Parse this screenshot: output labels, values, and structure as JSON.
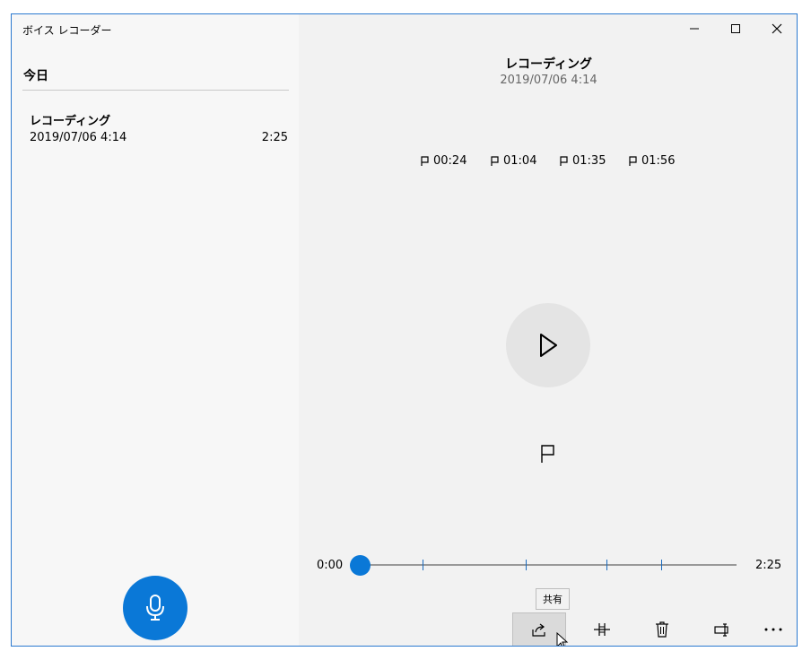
{
  "app": {
    "title": "ボイス レコーダー"
  },
  "sidebar": {
    "section_title": "今日",
    "recordings": [
      {
        "name": "レコーディング",
        "date": "2019/07/06 4:14",
        "duration": "2:25"
      }
    ]
  },
  "player": {
    "title": "レコーディング",
    "date": "2019/07/06 4:14",
    "markers": [
      "00:24",
      "01:04",
      "01:35",
      "01:56"
    ],
    "time_start": "0:00",
    "time_end": "2:25",
    "position_fraction": 0.0,
    "marker_fractions": [
      0.166,
      0.441,
      0.655,
      0.8
    ]
  },
  "toolbar": {
    "share_tooltip": "共有"
  },
  "colors": {
    "accent": "#0a78d7",
    "window_border": "#2b79d0"
  }
}
